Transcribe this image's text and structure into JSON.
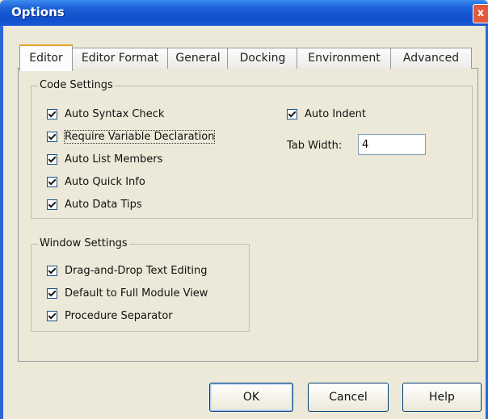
{
  "window": {
    "title": "Options",
    "close_glyph": "x"
  },
  "tabs": [
    {
      "label": "Editor",
      "active": true
    },
    {
      "label": "Editor Format",
      "active": false
    },
    {
      "label": "General",
      "active": false
    },
    {
      "label": "Docking",
      "active": false
    },
    {
      "label": "Environment",
      "active": false
    },
    {
      "label": "Advanced",
      "active": false
    }
  ],
  "code_settings": {
    "legend": "Code Settings",
    "options": [
      {
        "label": "Auto Syntax Check",
        "checked": true
      },
      {
        "label": "Require Variable Declaration",
        "checked": true
      },
      {
        "label": "Auto List Members",
        "checked": true
      },
      {
        "label": "Auto Quick Info",
        "checked": true
      },
      {
        "label": "Auto Data Tips",
        "checked": true
      }
    ],
    "auto_indent": {
      "label": "Auto Indent",
      "checked": true
    },
    "tab_width": {
      "label": "Tab Width:",
      "value": "4"
    }
  },
  "window_settings": {
    "legend": "Window Settings",
    "options": [
      {
        "label": "Drag-and-Drop Text Editing",
        "checked": true
      },
      {
        "label": "Default to Full Module View",
        "checked": true
      },
      {
        "label": "Procedure Separator",
        "checked": true
      }
    ]
  },
  "buttons": {
    "ok": "OK",
    "cancel": "Cancel",
    "help": "Help"
  }
}
